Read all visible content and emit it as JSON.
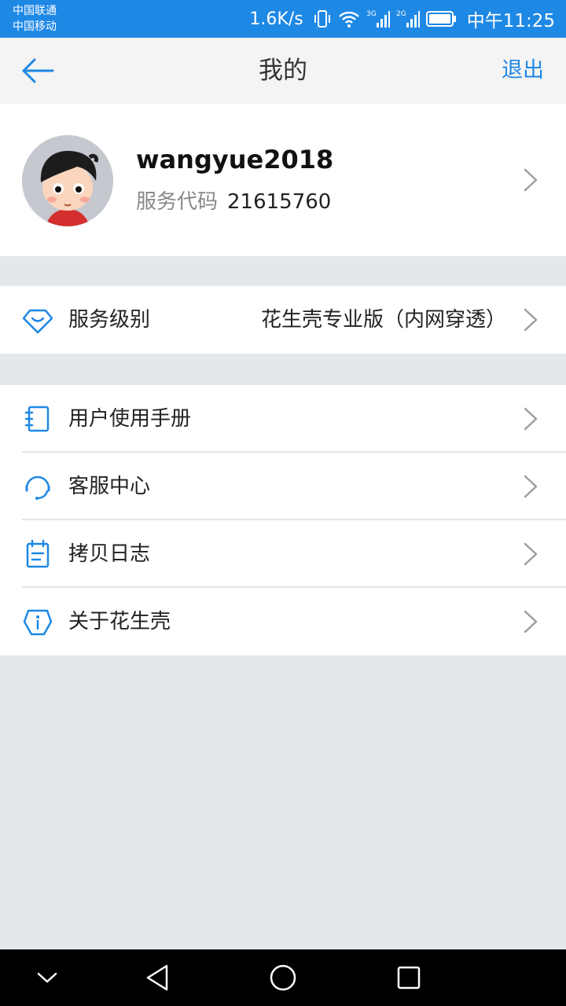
{
  "status_bar": {
    "carrier_1": "中国联通",
    "carrier_2": "中国移动",
    "net_speed": "1.6K/s",
    "signal_1_label": "3G",
    "signal_2_label": "2G",
    "time": "中午11:25",
    "color": "#1e88e5"
  },
  "app_bar": {
    "title": "我的",
    "logout_label": "退出",
    "back_icon": "arrow-left-icon"
  },
  "profile": {
    "username": "wangyue2018",
    "code_label": "服务代码",
    "code_value": "21615760"
  },
  "service": {
    "label": "服务级别",
    "value": "花生壳专业版（内网穿透）",
    "icon": "diamond-icon"
  },
  "menu": {
    "items": [
      {
        "label": "用户使用手册",
        "icon": "notebook-icon"
      },
      {
        "label": "客服中心",
        "icon": "headset-icon"
      },
      {
        "label": "拷贝日志",
        "icon": "log-icon"
      },
      {
        "label": "关于花生壳",
        "icon": "info-icon"
      }
    ]
  },
  "colors": {
    "accent": "#1e88e5",
    "background": "#e4e7eb"
  }
}
